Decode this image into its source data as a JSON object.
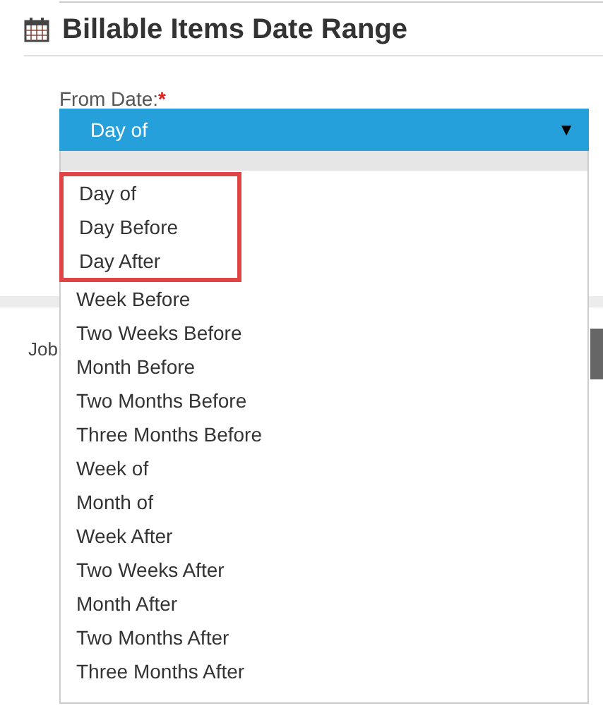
{
  "section": {
    "title": "Billable Items Date Range"
  },
  "from_date": {
    "label": "From Date:",
    "required_mark": "*",
    "value": "Day of",
    "arrow": "▼"
  },
  "dropdown_options": [
    {
      "label": "Day of",
      "highlighted": true
    },
    {
      "label": "Day Before",
      "highlighted": true
    },
    {
      "label": "Day After",
      "highlighted": true
    },
    {
      "label": "Week Before",
      "highlighted": false
    },
    {
      "label": "Two Weeks Before",
      "highlighted": false
    },
    {
      "label": "Month Before",
      "highlighted": false
    },
    {
      "label": "Two Months Before",
      "highlighted": false
    },
    {
      "label": "Three Months Before",
      "highlighted": false
    },
    {
      "label": "Week of",
      "highlighted": false
    },
    {
      "label": "Month of",
      "highlighted": false
    },
    {
      "label": "Week After",
      "highlighted": false
    },
    {
      "label": "Two Weeks After",
      "highlighted": false
    },
    {
      "label": "Month After",
      "highlighted": false
    },
    {
      "label": "Two Months After",
      "highlighted": false
    },
    {
      "label": "Three Months After",
      "highlighted": false
    }
  ],
  "background": {
    "job_label": "Job"
  }
}
